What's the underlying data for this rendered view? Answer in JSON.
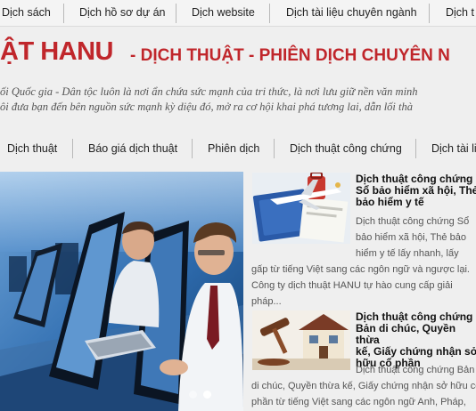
{
  "top_nav": {
    "items": [
      "Dịch sách",
      "Dịch hồ sơ dự án",
      "Dịch website",
      "Dịch tài liệu chuyên ngành",
      "Dịch t"
    ]
  },
  "brand": {
    "name": "ẬT HANU",
    "tagline": "- DỊCH THUẬT - PHIÊN DỊCH CHUYÊN N"
  },
  "quote": {
    "line1": "ối Quốc gia - Dân tộc luôn là nơi ẩn chứa sức mạnh của tri thức, là nơi lưu giữ nền văn minh",
    "line2": "ôi đưa bạn đến bên nguồn sức mạnh kỳ diệu đó, mở ra cơ hội khai phá tương lai, dẫn lối thà"
  },
  "main_nav": {
    "items": [
      "Dịch thuật",
      "Báo giá dịch thuật",
      "Phiên dịch",
      "Dịch thuật công chứng",
      "Dịch tài li"
    ]
  },
  "slider": {
    "active_slide": 2,
    "slide_count": 2
  },
  "articles": [
    {
      "title_lines": [
        "Dịch thuật công chứng",
        "Sổ bảo hiểm xã hội, Thẻ",
        "bảo hiểm y tế"
      ],
      "excerpt_lines": [
        "Dịch thuật công chứng Sổ",
        "bảo hiểm xã hội, Thẻ bảo",
        "hiểm y tế lấy nhanh, lấy",
        "gấp từ tiếng Việt sang các ngôn ngữ và ngược lại.",
        "Công ty dịch thuật HANU tự hào cung cấp giải",
        "pháp..."
      ]
    },
    {
      "title_lines": [
        "Dịch thuật công chứng",
        "Bản di chúc, Quyền thừa",
        "kế, Giấy chứng nhận sở",
        "hữu cổ phần"
      ],
      "excerpt_lines": [
        "Dịch thuật công chứng Bản",
        "di chúc, Quyền thừa kế, Giấy chứng nhận sở hữu cổ",
        "phần từ tiếng Việt sang các ngôn ngữ Anh, Pháp,"
      ]
    }
  ],
  "colors": {
    "brand_red": "#c0262b",
    "page_bg": "#efefef",
    "nav_text": "#222222"
  }
}
